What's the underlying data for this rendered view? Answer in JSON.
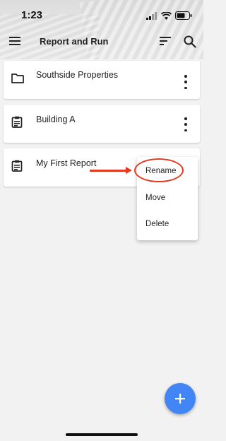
{
  "status_bar": {
    "time": "1:23"
  },
  "header": {
    "title": "Report and Run"
  },
  "items": [
    {
      "label": "Southside Properties",
      "icon": "folder-icon"
    },
    {
      "label": "Building A",
      "icon": "clipboard-icon"
    },
    {
      "label": "My First Report",
      "icon": "clipboard-icon"
    }
  ],
  "context_menu": {
    "items": [
      "Rename",
      "Move",
      "Delete"
    ]
  },
  "colors": {
    "fab": "#4285f4",
    "annotation": "#e33a1f"
  }
}
